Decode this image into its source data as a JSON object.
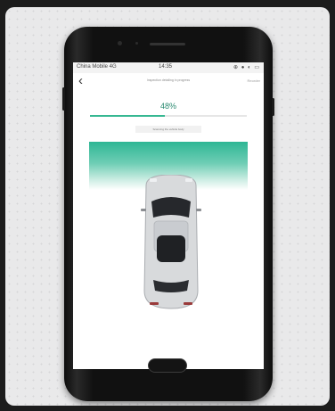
{
  "statusbar": {
    "carrier": "China Mobile 4G",
    "time": "14:35",
    "icons": "⊕ ● ◐ ▭"
  },
  "navbar": {
    "back_icon": "‹",
    "title": "Inspection detailing in progress",
    "action": "Reorder"
  },
  "progress": {
    "percent_label": "48%",
    "value": 0.48,
    "step_label": "Scanning the vehicle body",
    "accent_color": "#37b892"
  },
  "scan_panel": {
    "colors": [
      "#2eb694",
      "#cfeee5"
    ]
  },
  "car": {
    "icon": "car-top-view-icon",
    "body_color": "#d8dadc"
  }
}
